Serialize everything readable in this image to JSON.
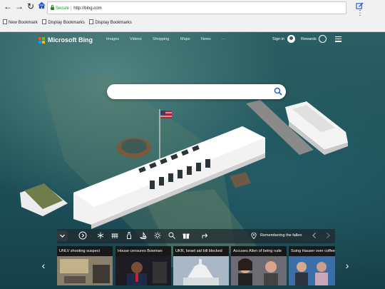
{
  "browser": {
    "secure_label": "Secure",
    "url": "http://bing.com",
    "bookmarks": [
      "New Bookmark",
      "Display Bookmarks",
      "Display Bookmarks"
    ]
  },
  "bing": {
    "logo_text": "Microsoft Bing",
    "nav": [
      "Images",
      "Videos",
      "Shopping",
      "Maps",
      "News",
      "···"
    ],
    "signin": "Sign in",
    "rewards": "Rewards",
    "search_placeholder": "",
    "image_caption": "Remembering the fallen",
    "news": [
      "UNLV shooting suspect",
      "House censures Bowman",
      "UKR, Israel aid bill blocked",
      "Accuses Allen of being rude",
      "Suing Hauser over coffee"
    ]
  },
  "colors": {
    "windows_logo": [
      "#f25022",
      "#7fba00",
      "#00a4ef",
      "#ffb900"
    ],
    "secure": "#1a8d1a",
    "nav_icon": "#1a56db"
  }
}
